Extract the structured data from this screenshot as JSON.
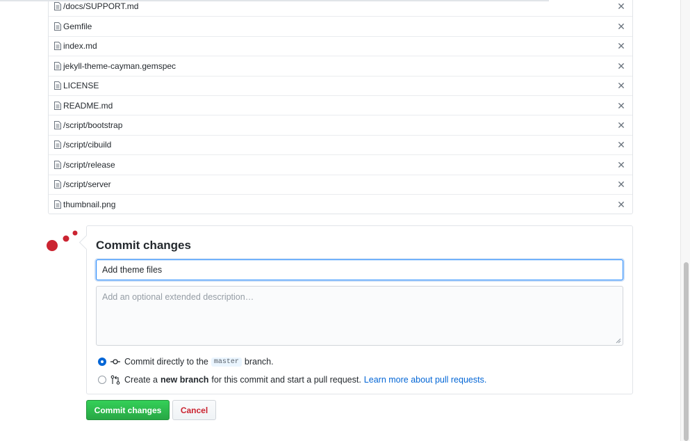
{
  "files": [
    {
      "name": "/docs/SUPPORT.md"
    },
    {
      "name": "Gemfile"
    },
    {
      "name": "index.md"
    },
    {
      "name": "jekyll-theme-cayman.gemspec"
    },
    {
      "name": "LICENSE"
    },
    {
      "name": "README.md"
    },
    {
      "name": "/script/bootstrap"
    },
    {
      "name": "/script/cibuild"
    },
    {
      "name": "/script/release"
    },
    {
      "name": "/script/server"
    },
    {
      "name": "thumbnail.png"
    }
  ],
  "remove_icon_glyph": "✕",
  "commit": {
    "title": "Commit changes",
    "summary_value": "Add theme files",
    "description_placeholder": "Add an optional extended description…",
    "option_direct": {
      "prefix": "Commit directly to the",
      "branch": "master",
      "suffix": "branch."
    },
    "option_new_branch": {
      "prefix": "Create a",
      "bold": "new branch",
      "suffix": "for this commit and start a pull request.",
      "link": "Learn more about pull requests."
    },
    "selected_option": "direct",
    "commit_button": "Commit changes",
    "cancel_button": "Cancel"
  },
  "icons": {
    "file": "file-icon",
    "commit": "git-commit-icon",
    "pull_request": "git-pull-request-icon",
    "avatar": "identicon-avatar"
  },
  "colors": {
    "primary_button": "#28a745",
    "cancel_text": "#cb2431",
    "link": "#0366d6",
    "avatar": "#cb2431"
  }
}
